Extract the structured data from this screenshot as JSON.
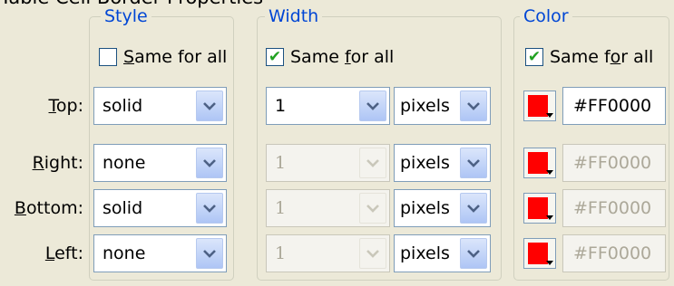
{
  "clipped_header": "Table Cell Border Properties",
  "groups": {
    "style": {
      "legend": "Style",
      "same_for_all": {
        "label": "Same for all",
        "checked": false
      }
    },
    "width": {
      "legend": "Width",
      "same_for_all": {
        "label": "Same for all",
        "checked": true
      }
    },
    "color": {
      "legend": "Color",
      "same_for_all": {
        "label": "Same for all",
        "checked": true
      }
    }
  },
  "rows": [
    {
      "label": "Top:",
      "style": "solid",
      "width": "1",
      "unit": "pixels",
      "color": "#FF0000",
      "width_enabled": true,
      "color_enabled": true,
      "swatch_color": "#ff0000"
    },
    {
      "label": "Right:",
      "style": "none",
      "width": "1",
      "unit": "pixels",
      "color": "#FF0000",
      "width_enabled": false,
      "color_enabled": false,
      "swatch_color": "#ff0000"
    },
    {
      "label": "Bottom:",
      "style": "solid",
      "width": "1",
      "unit": "pixels",
      "color": "#FF0000",
      "width_enabled": false,
      "color_enabled": false,
      "swatch_color": "#ff0000"
    },
    {
      "label": "Left:",
      "style": "none",
      "width": "1",
      "unit": "pixels",
      "color": "#FF0000",
      "width_enabled": false,
      "color_enabled": false,
      "swatch_color": "#ff0000"
    }
  ],
  "icons": {
    "dropdown": "chevron-down-icon",
    "check": "checkmark-icon",
    "swatch_arrow": "triangle-down-icon"
  },
  "colors": {
    "legend_text": "#0046d5",
    "checkmark": "#21a121",
    "dialog_bg": "#ece9d8",
    "disabled_text": "#aca899"
  }
}
